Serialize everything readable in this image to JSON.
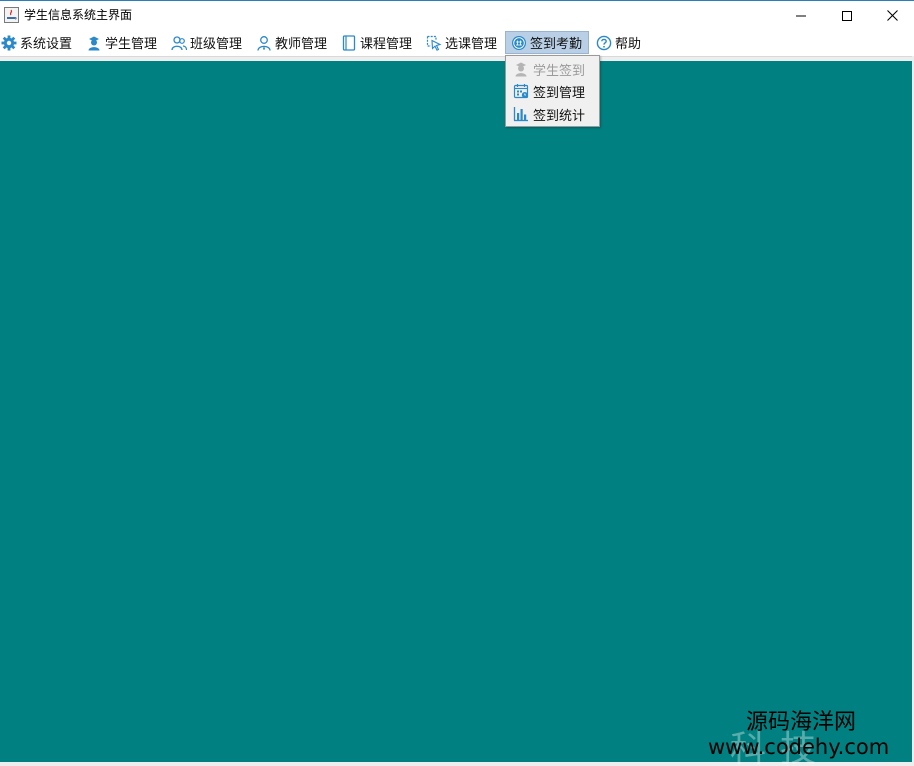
{
  "window": {
    "title": "学生信息系统主界面"
  },
  "menubar": {
    "items": [
      {
        "label": "系统设置",
        "icon": "gear-icon"
      },
      {
        "label": "学生管理",
        "icon": "student-icon"
      },
      {
        "label": "班级管理",
        "icon": "class-group-icon"
      },
      {
        "label": "教师管理",
        "icon": "teacher-icon"
      },
      {
        "label": "课程管理",
        "icon": "course-book-icon"
      },
      {
        "label": "选课管理",
        "icon": "select-cursor-icon"
      },
      {
        "label": "签到考勤",
        "icon": "attendance-icon"
      },
      {
        "label": "帮助",
        "icon": "help-icon"
      }
    ],
    "active_index": 6
  },
  "dropdown": {
    "items": [
      {
        "label": "学生签到",
        "icon": "student-checkin-icon",
        "enabled": false
      },
      {
        "label": "签到管理",
        "icon": "calendar-icon",
        "enabled": true
      },
      {
        "label": "签到统计",
        "icon": "bar-chart-icon",
        "enabled": true
      }
    ]
  },
  "desktop": {
    "background_color": "#008080"
  },
  "watermark": {
    "line1": "源码海洋网",
    "line2": "www.codehy.com",
    "faint": "科技"
  },
  "colors": {
    "accent_blue": "#2b7fb8",
    "menu_active_bg": "#b8cfe5",
    "icon_blue": "#2a89c9"
  }
}
